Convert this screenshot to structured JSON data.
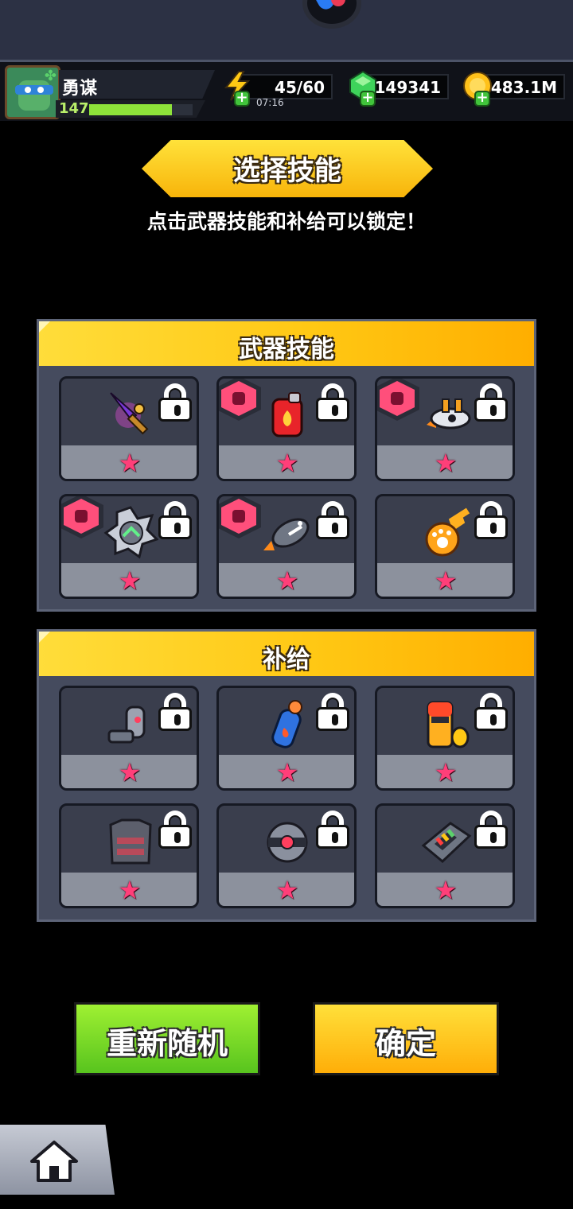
{
  "player": {
    "name": "勇谋",
    "level": "147",
    "xp_fraction": 0.8
  },
  "resources": {
    "energy": {
      "value": "45/60",
      "timer": "07:16",
      "icon": "lightning-icon"
    },
    "gems": {
      "value": "149341",
      "icon": "green-gem-icon"
    },
    "coins": {
      "value": "483.1M",
      "icon": "gold-coin-icon"
    }
  },
  "screen": {
    "title": "选择技能",
    "subtitle": "点击武器技能和补给可以锁定！"
  },
  "weapon_skills": {
    "title": "武器技能",
    "items": [
      {
        "icon": "purple-blade-icon",
        "badge": false,
        "locked": true
      },
      {
        "icon": "red-fuel-can-icon",
        "badge": true,
        "locked": true
      },
      {
        "icon": "drone-icon",
        "badge": true,
        "locked": true
      },
      {
        "icon": "spiked-orb-icon",
        "badge": true,
        "locked": true
      },
      {
        "icon": "shark-missile-icon",
        "badge": true,
        "locked": true
      },
      {
        "icon": "paw-meteor-icon",
        "badge": false,
        "locked": true
      }
    ]
  },
  "supplies": {
    "title": "补给",
    "items": [
      {
        "icon": "robot-arm-icon",
        "locked": true
      },
      {
        "icon": "blue-flask-icon",
        "locked": true
      },
      {
        "icon": "battery-icon",
        "locked": true
      },
      {
        "icon": "armor-vest-icon",
        "locked": true
      },
      {
        "icon": "spiked-ring-icon",
        "locked": true
      },
      {
        "icon": "energy-cell-icon",
        "locked": true
      }
    ]
  },
  "actions": {
    "reroll_label": "重新随机",
    "confirm_label": "确定"
  },
  "nav": {
    "home_icon": "home-icon"
  }
}
